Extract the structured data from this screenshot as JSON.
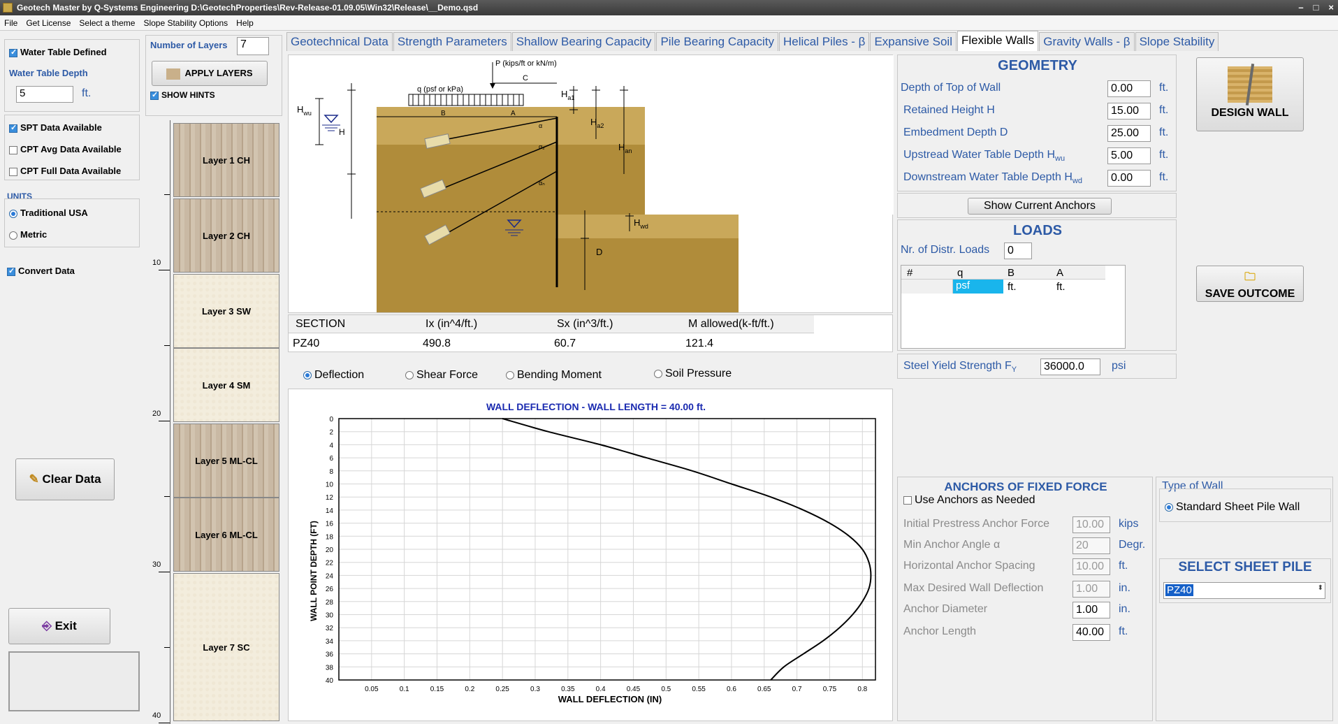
{
  "window": {
    "title": "Geotech Master by Q-Systems Engineering   D:\\GeotechProperties\\Rev-Release-01.09.05\\Win32\\Release\\__Demo.qsd",
    "minimize": "–",
    "maximize": "□",
    "close": "×"
  },
  "menu": [
    "File",
    "Get License",
    "Select a theme",
    "Slope Stability Options",
    "Help"
  ],
  "left": {
    "water_table_defined": "Water Table Defined",
    "water_table_depth_label": "Water Table Depth",
    "water_table_depth_value": "5",
    "water_table_unit": "ft.",
    "spt": "SPT Data Available",
    "cpt_avg": "CPT Avg Data Available",
    "cpt_full": "CPT Full Data Available",
    "units_label": "UNITS",
    "unit_usa": "Traditional USA",
    "unit_metric": "Metric",
    "convert": "Convert Data",
    "clear": "Clear Data",
    "exit": "Exit"
  },
  "layers_panel": {
    "num_label": "Number of Layers",
    "num_value": "7",
    "apply": "APPLY LAYERS",
    "show_hints": "SHOW HINTS"
  },
  "layers": [
    "Layer 1 CH",
    "Layer 2 CH",
    "Layer 3 SW",
    "Layer 4 SM",
    "Layer 5 ML-CL",
    "Layer 6 ML-CL",
    "Layer 7 SC"
  ],
  "depth_ticks": [
    "10",
    "20",
    "30",
    "40"
  ],
  "tabs": [
    "Geotechnical Data",
    "Strength Parameters",
    "Shallow Bearing Capacity",
    "Pile Bearing Capacity",
    "Helical Piles - β",
    "Expansive Soil",
    "Flexible Walls",
    "Gravity Walls - β",
    "Slope Stability"
  ],
  "diagram": {
    "P": "P (kips/ft or kN/m)",
    "q": "q (psf or kPa)",
    "C": "C",
    "B": "B",
    "A": "A",
    "Hwu": "H",
    "Hwu_sub": "wu",
    "H": "H",
    "Ha1": "H",
    "Ha1_sub": "a1",
    "Ha2": "H",
    "Ha2_sub": "a2",
    "Han": "H",
    "Han_sub": "an",
    "Hwd": "H",
    "Hwd_sub": "wd",
    "D": "D",
    "alpha": "α",
    "alpha2": "α₂",
    "alphan": "αₙ"
  },
  "section": {
    "headers": [
      "SECTION",
      "Ix (in^4/ft.)",
      "Sx (in^3/ft.)",
      "M allowed(k-ft/ft.)"
    ],
    "row": [
      "PZ40",
      "490.8",
      "60.7",
      "121.4"
    ]
  },
  "plot_options": [
    "Deflection",
    "Shear Force",
    "Bending Moment",
    "Soil Pressure"
  ],
  "geometry": {
    "title": "GEOMETRY",
    "rows": [
      {
        "label": "Depth of Top of Wall",
        "value": "0.00",
        "unit": "ft."
      },
      {
        "label": "Retained Height  H",
        "value": "15.00",
        "unit": "ft."
      },
      {
        "label": "Embedment Depth D",
        "value": "25.00",
        "unit": "ft."
      },
      {
        "label": "Upstread Water Table Depth H",
        "sub": "wu",
        "value": "5.00",
        "unit": "ft."
      },
      {
        "label": "Downstream Water Table Depth H",
        "sub": "wd",
        "value": "0.00",
        "unit": "ft."
      }
    ],
    "show_anchors": "Show Current Anchors"
  },
  "loads": {
    "title": "LOADS",
    "nr_label": "Nr. of Distr. Loads",
    "nr_value": "0",
    "cols": [
      "#",
      "q",
      "B",
      "A"
    ],
    "units": [
      "",
      "psf",
      "ft.",
      "ft."
    ]
  },
  "steel": {
    "label": "Steel Yield Strength F",
    "sub": "Y",
    "value": "36000.0",
    "unit": "psi"
  },
  "design_wall": "DESIGN WALL",
  "save_outcome": "SAVE OUTCOME",
  "anchors": {
    "title": "ANCHORS OF FIXED FORCE",
    "use_label": "Use Anchors as Needed",
    "rows": [
      {
        "label": "Initial Prestress Anchor Force",
        "value": "10.00",
        "unit": "kips",
        "disabled": true
      },
      {
        "label": "Min Anchor Angle α",
        "value": "20",
        "unit": "Degr.",
        "disabled": true
      },
      {
        "label": "Horizontal Anchor Spacing",
        "value": "10.00",
        "unit": "ft.",
        "disabled": true
      },
      {
        "label": "Max Desired Wall Deflection",
        "value": "1.00",
        "unit": "in.",
        "disabled": true
      },
      {
        "label": "Anchor Diameter",
        "value": "1.00",
        "unit": "in.",
        "disabled": false
      },
      {
        "label": "Anchor Length",
        "value": "40.00",
        "unit": "ft.",
        "disabled": false
      }
    ]
  },
  "wall_type": {
    "title": "Type of Wall",
    "option": "Standard Sheet Pile Wall"
  },
  "sheet_pile": {
    "title": "SELECT SHEET PILE",
    "value": "PZ40"
  },
  "chart_data": {
    "type": "line",
    "title": "WALL DEFLECTION  -  WALL LENGTH = 40.00 ft.",
    "xlabel": "WALL DEFLECTION (IN)",
    "ylabel": "WALL POINT DEPTH (FT)",
    "xlim": [
      0,
      0.82
    ],
    "ylim": [
      40,
      0
    ],
    "xticks": [
      "0.05",
      "0.1",
      "0.15",
      "0.2",
      "0.25",
      "0.3",
      "0.35",
      "0.4",
      "0.45",
      "0.5",
      "0.55",
      "0.6",
      "0.65",
      "0.7",
      "0.75",
      "0.8"
    ],
    "yticks": [
      "0",
      "2",
      "4",
      "6",
      "8",
      "10",
      "12",
      "14",
      "16",
      "18",
      "20",
      "22",
      "24",
      "26",
      "28",
      "30",
      "32",
      "34",
      "36",
      "38",
      "40"
    ],
    "grid": true,
    "x": [
      0.25,
      0.32,
      0.4,
      0.47,
      0.54,
      0.6,
      0.66,
      0.71,
      0.75,
      0.78,
      0.8,
      0.81,
      0.813,
      0.81,
      0.8,
      0.785,
      0.765,
      0.74,
      0.71,
      0.68,
      0.66
    ],
    "y": [
      0,
      2,
      4,
      6,
      8,
      10,
      12,
      14,
      16,
      18,
      20,
      22,
      24,
      26,
      28,
      30,
      32,
      34,
      36,
      38,
      40
    ]
  }
}
